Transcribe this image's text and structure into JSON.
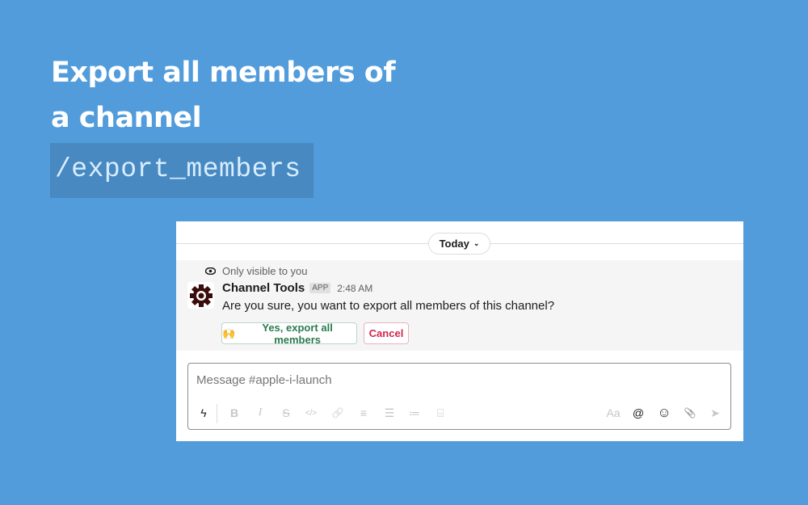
{
  "headline": {
    "line1": "Export all members of",
    "line2": "a channel",
    "command": "/export_members"
  },
  "panel": {
    "date_divider": {
      "label": "Today",
      "chevron": "⌄"
    },
    "message": {
      "visibility_note": "Only visible to you",
      "sender": "Channel Tools",
      "badge": "APP",
      "time": "2:48 AM",
      "text": "Are you sure, you want to export all members of this channel?",
      "confirm_button": {
        "emoji": "🙌",
        "label": "Yes, export all members"
      },
      "cancel_button": {
        "label": "Cancel"
      }
    },
    "composer": {
      "placeholder": "Message #apple-i-launch",
      "toolbar": {
        "shortcuts": "ϟ",
        "bold": "B",
        "italic": "I",
        "strike": "S",
        "code": "</>",
        "link": "🔗",
        "ordered_list": "≡",
        "bullet_list": "☰",
        "quote": "≔",
        "code_block": "⌸",
        "format": "Aa",
        "mention": "@",
        "emoji": "☺",
        "attach": "📎",
        "send": "➤"
      }
    }
  }
}
